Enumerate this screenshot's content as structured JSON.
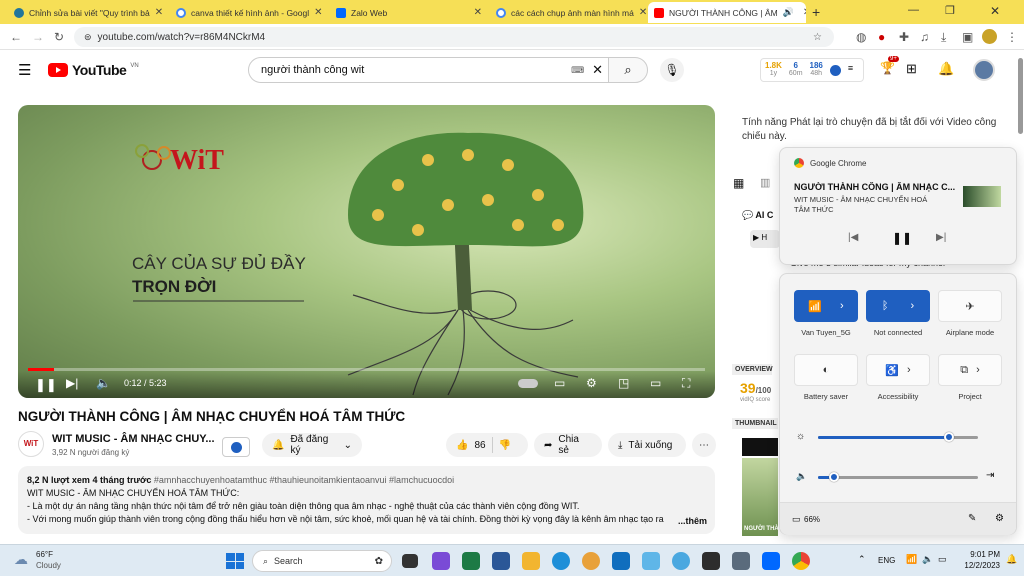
{
  "tabs": [
    {
      "label": "Chỉnh sửa bài viết \"Quy trình bả",
      "color": "#21759b"
    },
    {
      "label": "canva thiết kế hình ảnh - Googl",
      "color": "#4285f4"
    },
    {
      "label": "Zalo Web",
      "color": "#0068ff"
    },
    {
      "label": "các cách chụp ảnh màn hình má",
      "color": "#4285f4"
    },
    {
      "label": "NGƯỜI THÀNH CÔNG | ÂM",
      "color": "#ff0000"
    }
  ],
  "browser": {
    "url": "youtube.com/watch?v=r86M4NCkrM4"
  },
  "youtube": {
    "logo_text": "YouTube",
    "region": "VN",
    "search_value": "người thành công wit",
    "ext_stats": [
      "1.8K",
      "6",
      "186",
      "1y",
      "60m",
      "48h"
    ],
    "notif_count": "9+"
  },
  "video": {
    "brand": "WiT",
    "headline1": "CÂY CỦA SỰ ĐỦ ĐẦY",
    "headline2": "TRỌN ĐỜI",
    "time": "0:12 / 5:23",
    "progress": 0.038,
    "title": "NGƯỜI THÀNH CÔNG | ÂM NHẠC CHUYỂN HOÁ TÂM THỨC"
  },
  "channel": {
    "name": "WIT MUSIC - ÂM NHẠC CHUY...",
    "subs": "3,92 N người đăng ký",
    "subscribed_label": "Đã đăng ký",
    "likes": "86",
    "share_label": "Chia sẻ",
    "download_label": "Tải xuống"
  },
  "description": {
    "meta": "8,2 N lượt xem  4 tháng trước",
    "tags": "#amnhacchuyenhoatamthuc #thauhieunoitamkientaoanvui #lamchucuocdoi",
    "line1": "WIT MUSIC - ÂM NHẠC CHUYỂN HOÁ TÂM THỨC:",
    "line2": "- Là một dự án nâng tầng nhận thức nội tâm để trở nên giàu toàn diện thông qua âm nhạc - nghệ thuật của các thành viên cộng đồng WIT.",
    "line3": "- Với mong muốn giúp thành viên trong cộng đồng thấu hiểu hơn về nội tâm, sức khoẻ, mối quan hệ và tài chính. Đồng thời kỳ vọng đây là kênh âm nhạc tạo ra",
    "more": "...thêm"
  },
  "sidebar": {
    "chat_notice": "Tính năng Phát lại trò chuyện đã bị tắt đối với Video công chiếu này.",
    "ai_label": "AI C",
    "suggestion": "Give me 3 similar ideas for my channel",
    "overview": "OVERVIEW",
    "score": "39",
    "score_total": "/100",
    "score_label": "vidIQ score",
    "thumbnail_label": "THUMBNAIL",
    "thumb_caption": "NGƯỜI THÀNH"
  },
  "media_popup": {
    "app": "Google Chrome",
    "title": "NGƯỜI THÀNH CÔNG | ÂM NHẠC C...",
    "subtitle": "WIT MUSIC - ÂM NHẠC CHUYỂN HOÁ TÂM THỨC"
  },
  "quick_settings": {
    "wifi_label": "Van Tuyen_5G",
    "bt_label": "Not connected",
    "airplane_label": "Airplane mode",
    "battery_saver_label": "Battery saver",
    "accessibility_label": "Accessibility",
    "project_label": "Project",
    "brightness": 0.82,
    "volume": 0.1,
    "battery": "66%"
  },
  "taskbar": {
    "weather_temp": "66°F",
    "weather_desc": "Cloudy",
    "search_placeholder": "Search",
    "lang": "ENG",
    "time": "9:01 PM",
    "date": "12/2/2023"
  },
  "colors": {
    "accent": "#1f5fc0",
    "youtube_red": "#ff0000",
    "tabstrip": "#f6df56"
  }
}
